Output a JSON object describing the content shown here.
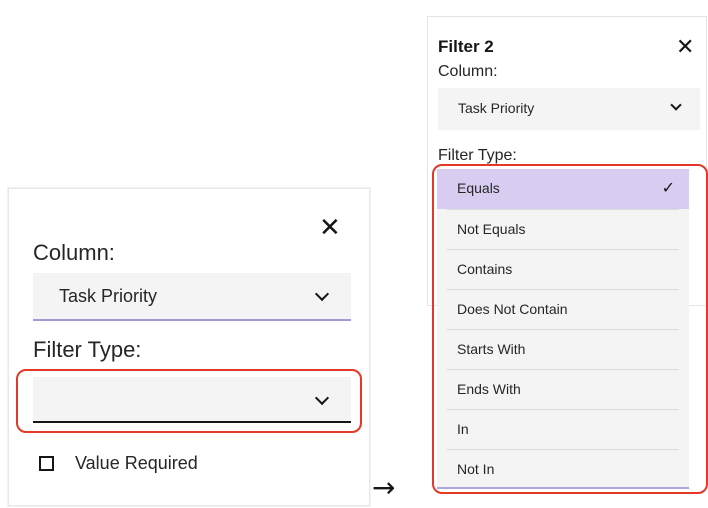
{
  "left_panel": {
    "close_icon": "✕",
    "column_label": "Column:",
    "column_value": "Task Priority",
    "filter_type_label": "Filter Type:",
    "filter_type_value": "",
    "checkbox_label": "Value Required",
    "checkbox_checked": false
  },
  "arrow": "→",
  "right_panel": {
    "title": "Filter 2",
    "close_icon": "✕",
    "column_label": "Column:",
    "column_value": "Task Priority",
    "filter_type_label": "Filter Type:",
    "options": [
      {
        "label": "Equals",
        "selected": true
      },
      {
        "label": "Not Equals",
        "selected": false
      },
      {
        "label": "Contains",
        "selected": false
      },
      {
        "label": "Does Not Contain",
        "selected": false
      },
      {
        "label": "Starts With",
        "selected": false
      },
      {
        "label": "Ends With",
        "selected": false
      },
      {
        "label": "In",
        "selected": false
      },
      {
        "label": "Not In",
        "selected": false
      }
    ],
    "check_icon": "✓"
  },
  "colors": {
    "highlight": "#e53826",
    "selected_bg": "#d8cdf0",
    "field_bg": "#f4f4f4",
    "accent_underline": "#a897d8"
  }
}
